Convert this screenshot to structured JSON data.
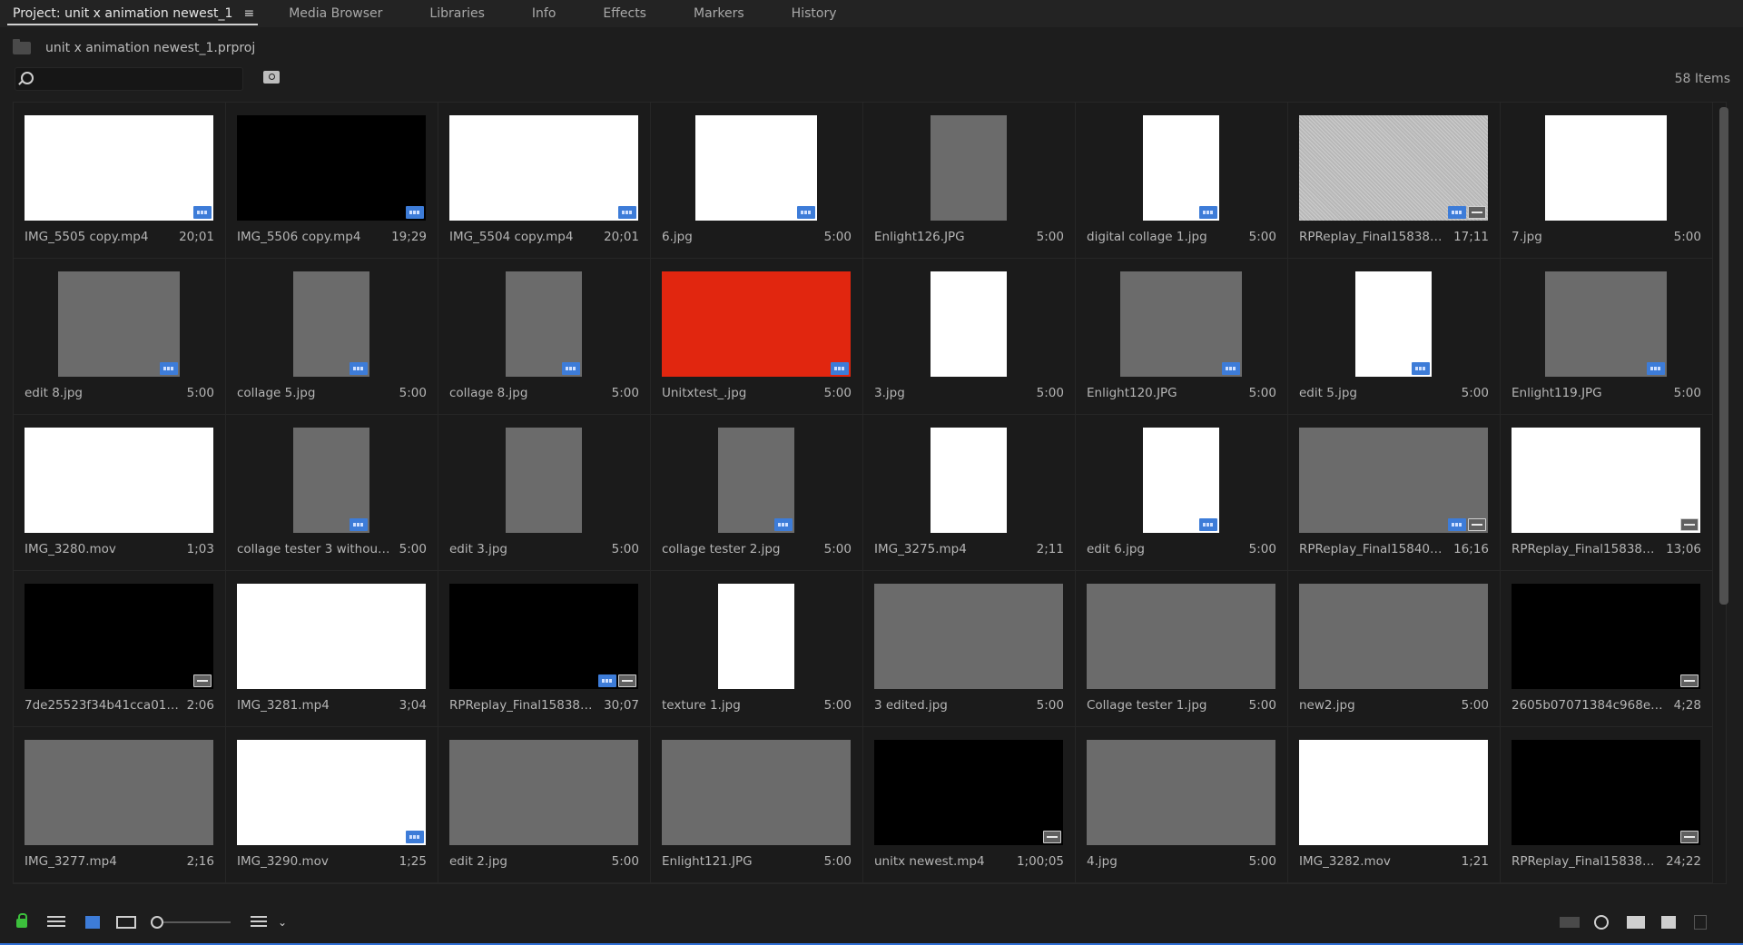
{
  "tabs": [
    {
      "label": "Project: unit x animation newest_1",
      "active": true
    },
    {
      "label": "Media Browser"
    },
    {
      "label": "Libraries"
    },
    {
      "label": "Info"
    },
    {
      "label": "Effects"
    },
    {
      "label": "Markers"
    },
    {
      "label": "History"
    }
  ],
  "tab_menu_icon": "≡",
  "project": {
    "file": "unit x animation newest_1.prproj"
  },
  "search": {
    "placeholder": "",
    "value": ""
  },
  "items_count": "58 Items",
  "colors": {
    "accent": "#3d7cd8",
    "lock": "#3cbf3c",
    "bottom_line": "#2f6ed4"
  },
  "grid": [
    {
      "name": "IMG_5505 copy.mp4",
      "dur": "20;01",
      "kind": "w",
      "bg": "white",
      "badges": [
        "vid"
      ]
    },
    {
      "name": "IMG_5506 copy.mp4",
      "dur": "19;29",
      "kind": "w",
      "bg": "black",
      "badges": [
        "vid"
      ]
    },
    {
      "name": "IMG_5504 copy.mp4",
      "dur": "20;01",
      "kind": "w",
      "bg": "white",
      "badges": [
        "vid"
      ]
    },
    {
      "name": "6.jpg",
      "dur": "5:00",
      "kind": "s",
      "bg": "white",
      "badges": [
        "vid"
      ]
    },
    {
      "name": "Enlight126.JPG",
      "dur": "5:00",
      "kind": "p",
      "bg": "gray",
      "badges": []
    },
    {
      "name": "digital collage 1.jpg",
      "dur": "5:00",
      "kind": "p",
      "bg": "white",
      "badges": [
        "vid"
      ]
    },
    {
      "name": "RPReplay_Final1583801…",
      "dur": "17;11",
      "kind": "w",
      "bg": "noise",
      "badges": [
        "vid",
        "aud"
      ]
    },
    {
      "name": "7.jpg",
      "dur": "5:00",
      "kind": "s",
      "bg": "white",
      "badges": []
    },
    {
      "name": "edit 8.jpg",
      "dur": "5:00",
      "kind": "s",
      "bg": "gray",
      "badges": [
        "vid"
      ]
    },
    {
      "name": "collage 5.jpg",
      "dur": "5:00",
      "kind": "p",
      "bg": "gray",
      "badges": [
        "vid"
      ]
    },
    {
      "name": "collage 8.jpg",
      "dur": "5:00",
      "kind": "p",
      "bg": "gray",
      "badges": [
        "vid"
      ]
    },
    {
      "name": "Unitxtest_.jpg",
      "dur": "5:00",
      "kind": "w",
      "bg": "red",
      "badges": [
        "vid"
      ]
    },
    {
      "name": "3.jpg",
      "dur": "5:00",
      "kind": "p",
      "bg": "white",
      "badges": []
    },
    {
      "name": "Enlight120.JPG",
      "dur": "5:00",
      "kind": "s",
      "bg": "gray",
      "badges": [
        "vid"
      ]
    },
    {
      "name": "edit 5.jpg",
      "dur": "5:00",
      "kind": "p",
      "bg": "white",
      "badges": [
        "vid"
      ]
    },
    {
      "name": "Enlight119.JPG",
      "dur": "5:00",
      "kind": "s",
      "bg": "gray",
      "badges": [
        "vid"
      ]
    },
    {
      "name": "IMG_3280.mov",
      "dur": "1;03",
      "kind": "w",
      "bg": "white",
      "badges": []
    },
    {
      "name": "collage tester 3 without m…",
      "dur": "5:00",
      "kind": "p",
      "bg": "gray",
      "badges": [
        "vid"
      ]
    },
    {
      "name": "edit 3.jpg",
      "dur": "5:00",
      "kind": "p",
      "bg": "gray",
      "badges": []
    },
    {
      "name": "collage tester 2.jpg",
      "dur": "5:00",
      "kind": "p",
      "bg": "gray",
      "badges": [
        "vid"
      ]
    },
    {
      "name": "IMG_3275.mp4",
      "dur": "2;11",
      "kind": "p",
      "bg": "white",
      "badges": []
    },
    {
      "name": "edit 6.jpg",
      "dur": "5:00",
      "kind": "p",
      "bg": "white",
      "badges": [
        "vid"
      ]
    },
    {
      "name": "RPReplay_Final1584020…",
      "dur": "16;16",
      "kind": "w",
      "bg": "gray",
      "badges": [
        "vid",
        "aud"
      ]
    },
    {
      "name": "RPReplay_Final1583801…",
      "dur": "13;06",
      "kind": "w",
      "bg": "white",
      "badges": [
        "aud"
      ]
    },
    {
      "name": "7de25523f34b41cca011d…",
      "dur": "2:06",
      "kind": "w",
      "bg": "black",
      "badges": [
        "aud"
      ]
    },
    {
      "name": "IMG_3281.mp4",
      "dur": "3;04",
      "kind": "w",
      "bg": "white",
      "badges": []
    },
    {
      "name": "RPReplay_Final1583801…",
      "dur": "30;07",
      "kind": "w",
      "bg": "black",
      "badges": [
        "vid",
        "aud"
      ]
    },
    {
      "name": "texture 1.jpg",
      "dur": "5:00",
      "kind": "p",
      "bg": "white",
      "badges": []
    },
    {
      "name": "3 edited.jpg",
      "dur": "5:00",
      "kind": "w",
      "bg": "gray",
      "badges": []
    },
    {
      "name": "Collage tester 1.jpg",
      "dur": "5:00",
      "kind": "w",
      "bg": "gray",
      "badges": []
    },
    {
      "name": "new2.jpg",
      "dur": "5:00",
      "kind": "w",
      "bg": "gray",
      "badges": []
    },
    {
      "name": "2605b07071384c968ee0b…",
      "dur": "4;28",
      "kind": "w",
      "bg": "black",
      "badges": [
        "aud"
      ]
    },
    {
      "name": "IMG_3277.mp4",
      "dur": "2;16",
      "kind": "w",
      "bg": "gray",
      "badges": []
    },
    {
      "name": "IMG_3290.mov",
      "dur": "1;25",
      "kind": "w",
      "bg": "white",
      "badges": [
        "vid"
      ]
    },
    {
      "name": "edit 2.jpg",
      "dur": "5:00",
      "kind": "w",
      "bg": "gray",
      "badges": []
    },
    {
      "name": "Enlight121.JPG",
      "dur": "5:00",
      "kind": "w",
      "bg": "gray",
      "badges": []
    },
    {
      "name": "unitx newest.mp4",
      "dur": "1;00;05",
      "kind": "w",
      "bg": "black",
      "badges": [
        "aud"
      ]
    },
    {
      "name": "4.jpg",
      "dur": "5:00",
      "kind": "w",
      "bg": "gray",
      "badges": []
    },
    {
      "name": "IMG_3282.mov",
      "dur": "1;21",
      "kind": "w",
      "bg": "white",
      "badges": []
    },
    {
      "name": "RPReplay_Final1583800…",
      "dur": "24;22",
      "kind": "w",
      "bg": "black",
      "badges": [
        "aud"
      ]
    }
  ],
  "bottom_icons": [
    "lock-icon",
    "list-view-icon",
    "icon-view-icon",
    "freeform-view-icon",
    "zoom-slider",
    "sort-icon",
    "chevron-down-icon",
    "automate-sequence-icon",
    "find-icon",
    "new-bin-icon",
    "new-item-icon",
    "trash-icon"
  ]
}
